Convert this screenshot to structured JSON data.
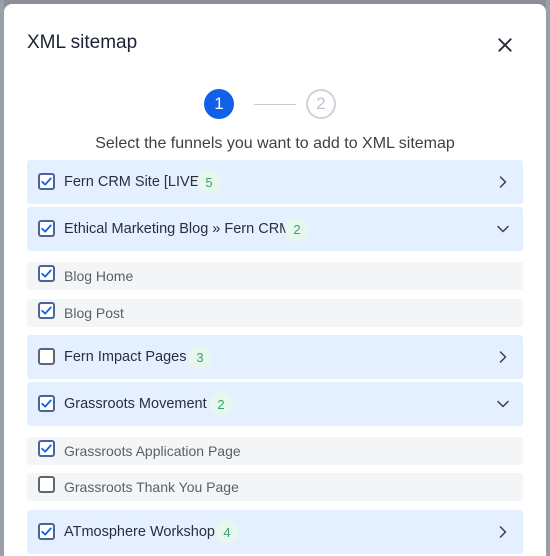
{
  "modal": {
    "title": "XML sitemap",
    "subtitle": "Select the funnels you want to add to XML sitemap"
  },
  "stepper": {
    "step1": "1",
    "step2": "2",
    "active_step": 1
  },
  "rows": [
    {
      "type": "funnel",
      "label": "Fern CRM Site [LIVE]",
      "count": "5",
      "checked": true,
      "expanded": false
    },
    {
      "type": "funnel",
      "label": "Ethical Marketing Blog » Fern CRM",
      "count": "2",
      "checked": true,
      "expanded": true
    },
    {
      "type": "page",
      "label": "Blog Home",
      "checked": true
    },
    {
      "type": "page",
      "label": "Blog Post",
      "checked": true
    },
    {
      "type": "funnel",
      "label": "Fern Impact Pages",
      "count": "3",
      "checked": false,
      "expanded": false
    },
    {
      "type": "funnel",
      "label": "Grassroots Movement",
      "count": "2",
      "checked": true,
      "expanded": true
    },
    {
      "type": "page",
      "label": "Grassroots Application Page",
      "checked": true
    },
    {
      "type": "page",
      "label": "Grassroots Thank You Page",
      "checked": false
    },
    {
      "type": "funnel",
      "label": "ATmosphere Workshop",
      "count": "4",
      "checked": true,
      "expanded": false
    }
  ],
  "colors": {
    "accent": "#1161e8",
    "funnel_row_bg": "#e4efff",
    "page_row_bg": "#f3f5f7",
    "count_bg": "#e7f6ef",
    "count_text": "#35a56c"
  },
  "icons": {
    "close": "close-icon",
    "collapsed": "chevron-right-icon",
    "expanded": "chevron-down-icon",
    "checked": "checkbox-checked-icon"
  }
}
